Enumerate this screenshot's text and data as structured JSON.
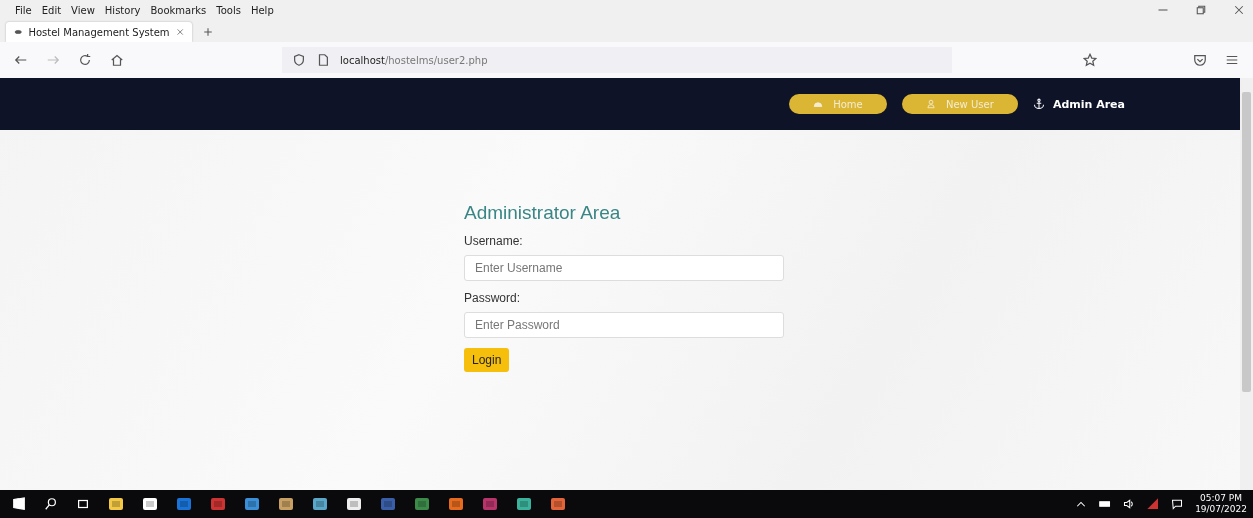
{
  "menu_bar": [
    "File",
    "Edit",
    "View",
    "History",
    "Bookmarks",
    "Tools",
    "Help"
  ],
  "tabs": [
    {
      "label": "Hostel Management System",
      "selected": true
    }
  ],
  "address_bar": {
    "host": "localhost",
    "path": "/hostelms/user2.php"
  },
  "site_nav": [
    {
      "label": "Home",
      "kind": "pill"
    },
    {
      "label": "New User",
      "kind": "pill"
    },
    {
      "label": "Admin Area",
      "kind": "link"
    }
  ],
  "login_form": {
    "title": "Administrator Area",
    "fields": [
      {
        "label": "Username:",
        "placeholder": "Enter Username"
      },
      {
        "label": "Password:",
        "placeholder": "Enter Password"
      }
    ],
    "button": "Login"
  },
  "taskbar": {
    "time": "05:07 PM",
    "date": "19/07/2022"
  }
}
